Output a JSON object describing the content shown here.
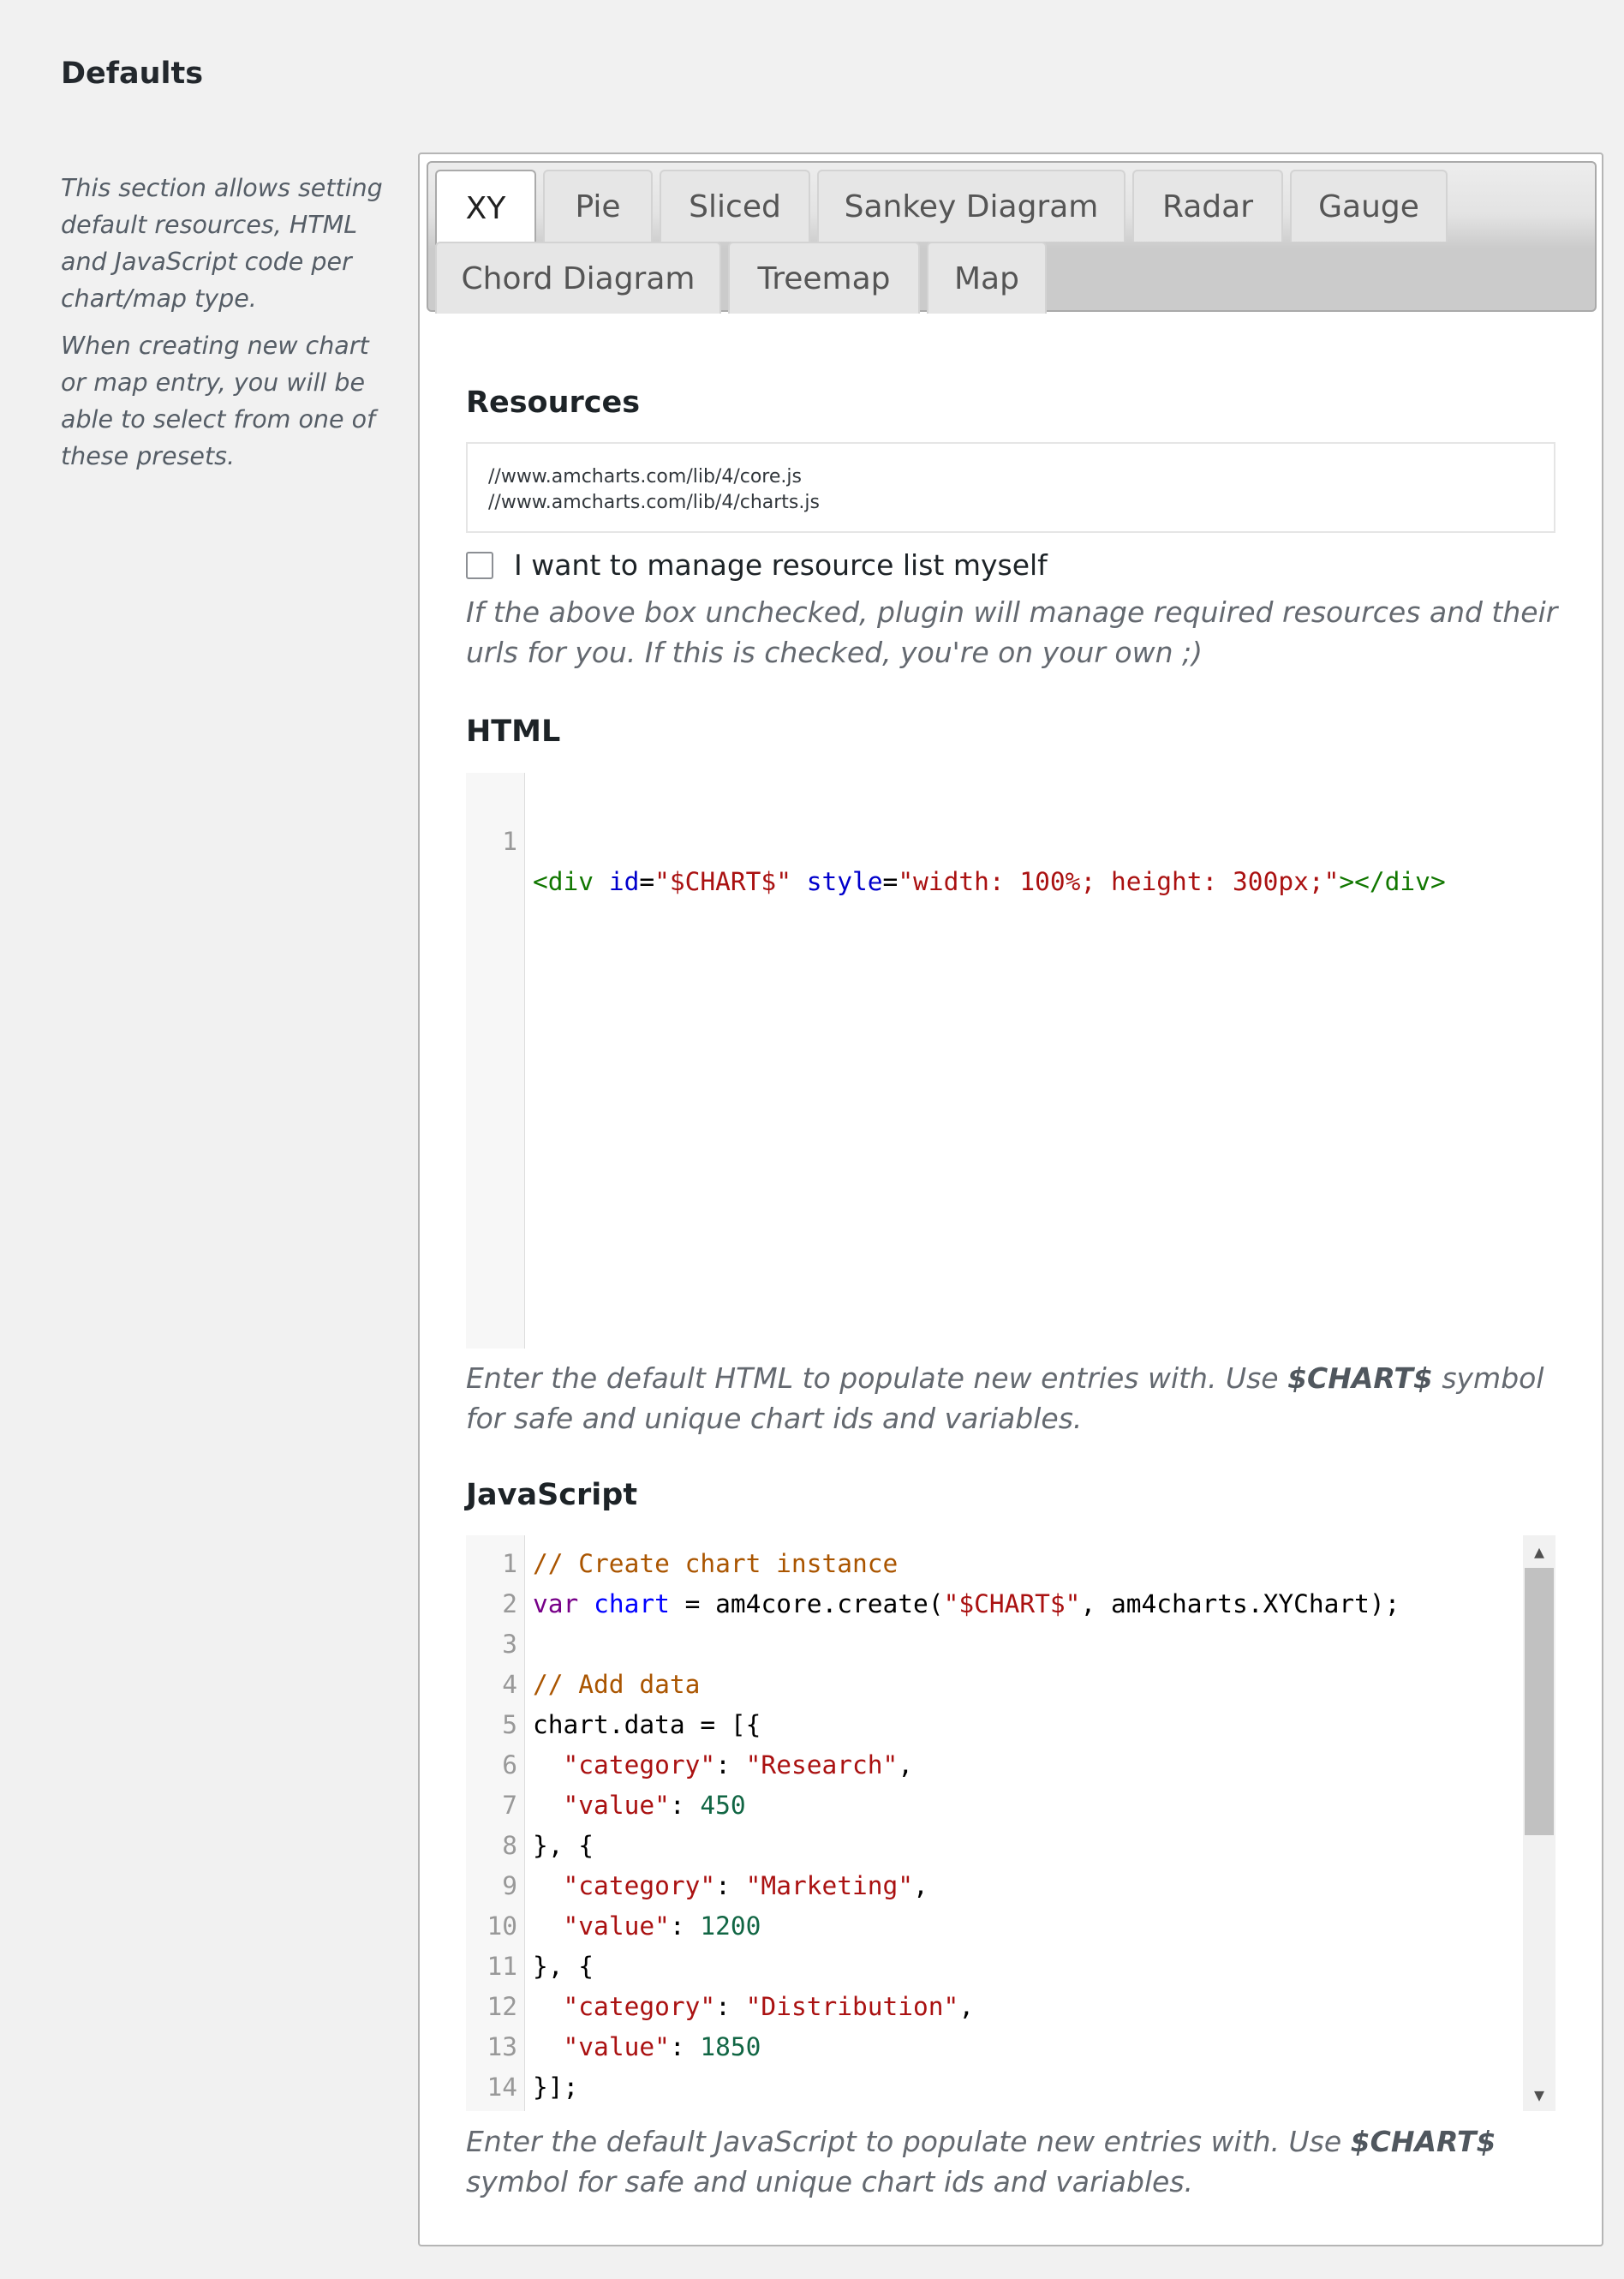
{
  "section": {
    "title": "Defaults",
    "description": [
      "This section allows setting default resources, HTML and JavaScript code per chart/map type.",
      "When creating new chart or map entry, you will be able to select from one of these presets."
    ]
  },
  "tabs": [
    {
      "label": "XY",
      "active": true
    },
    {
      "label": "Pie",
      "active": false
    },
    {
      "label": "Sliced",
      "active": false
    },
    {
      "label": "Sankey Diagram",
      "active": false
    },
    {
      "label": "Radar",
      "active": false
    },
    {
      "label": "Gauge",
      "active": false
    },
    {
      "label": "Chord Diagram",
      "active": false
    },
    {
      "label": "Treemap",
      "active": false
    },
    {
      "label": "Map",
      "active": false
    }
  ],
  "resources": {
    "heading": "Resources",
    "lines": [
      "//www.amcharts.com/lib/4/core.js",
      "//www.amcharts.com/lib/4/charts.js"
    ],
    "checkbox_label": "I want to manage resource list myself",
    "checkbox_checked": false,
    "help": "If the above box unchecked, plugin will manage required resources and their urls for you. If this is checked, you're on your own ;)"
  },
  "html": {
    "heading": "HTML",
    "code_line": "<div id=\"$CHART$\" style=\"width: 100%; height: 300px;\"></div>",
    "line_number": "1",
    "help_prefix": "Enter the default HTML to populate new entries with. Use ",
    "help_symbol": "$CHART$",
    "help_suffix": " symbol for safe and unique chart ids and variables."
  },
  "javascript": {
    "heading": "JavaScript",
    "lines": [
      "// Create chart instance",
      "var chart = am4core.create(\"$CHART$\", am4charts.XYChart);",
      "",
      "// Add data",
      "chart.data = [{",
      "  \"category\": \"Research\",",
      "  \"value\": 450",
      "}, {",
      "  \"category\": \"Marketing\",",
      "  \"value\": 1200",
      "}, {",
      "  \"category\": \"Distribution\",",
      "  \"value\": 1850",
      "}];"
    ],
    "help_prefix": "Enter the default JavaScript to populate new entries with. Use ",
    "help_symbol": "$CHART$",
    "help_suffix": " symbol for safe and unique chart ids and variables."
  }
}
